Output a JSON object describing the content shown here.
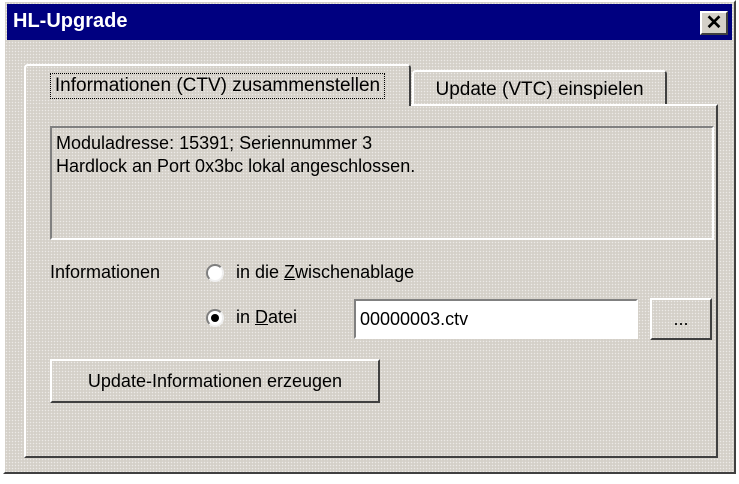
{
  "window": {
    "title": "HL-Upgrade",
    "close_symbol": "✕"
  },
  "tabs": [
    {
      "label": "Informationen (CTV) zusammenstellen",
      "active": true
    },
    {
      "label": "Update (VTC) einspielen",
      "active": false
    }
  ],
  "info": {
    "line1": "Moduladresse: 15391; Seriennummer 3",
    "line2": "Hardlock an Port 0x3bc lokal angeschlossen."
  },
  "options": {
    "group_label": "Informationen",
    "clipboard": {
      "prefix": "in die ",
      "accel": "Z",
      "suffix": "wischenablage",
      "selected": false
    },
    "file": {
      "prefix": "in ",
      "accel": "D",
      "suffix": "atei",
      "selected": true
    },
    "filename": "00000003.ctv",
    "browse_label": "..."
  },
  "actions": {
    "generate_label": "Update-Informationen erzeugen"
  }
}
